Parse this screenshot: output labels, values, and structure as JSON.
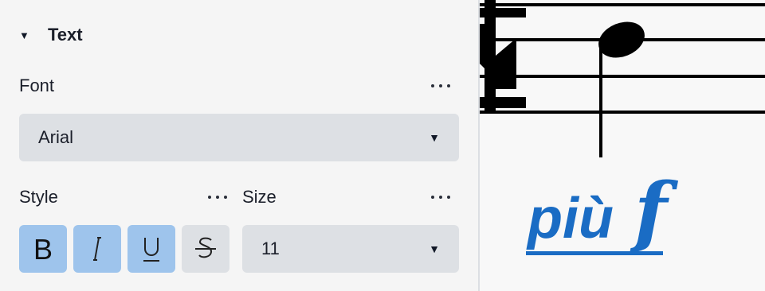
{
  "panel": {
    "section": {
      "title": "Text",
      "expanded": true
    },
    "font": {
      "label": "Font",
      "value": "Arial"
    },
    "style": {
      "label": "Style",
      "buttons": [
        {
          "icon": "bold-icon",
          "active": true
        },
        {
          "icon": "italic-icon",
          "active": true
        },
        {
          "icon": "underline-icon",
          "active": true
        },
        {
          "icon": "strikethrough-icon",
          "active": false
        }
      ]
    },
    "size": {
      "label": "Size",
      "value": "11"
    }
  },
  "score": {
    "dynamic_text": "più",
    "dynamic_marking": "f",
    "text_color": "#1a6cc4"
  },
  "colors": {
    "active_button": "#9ec4ec",
    "inactive_button": "#dde0e4",
    "panel_bg": "#f5f5f5"
  }
}
